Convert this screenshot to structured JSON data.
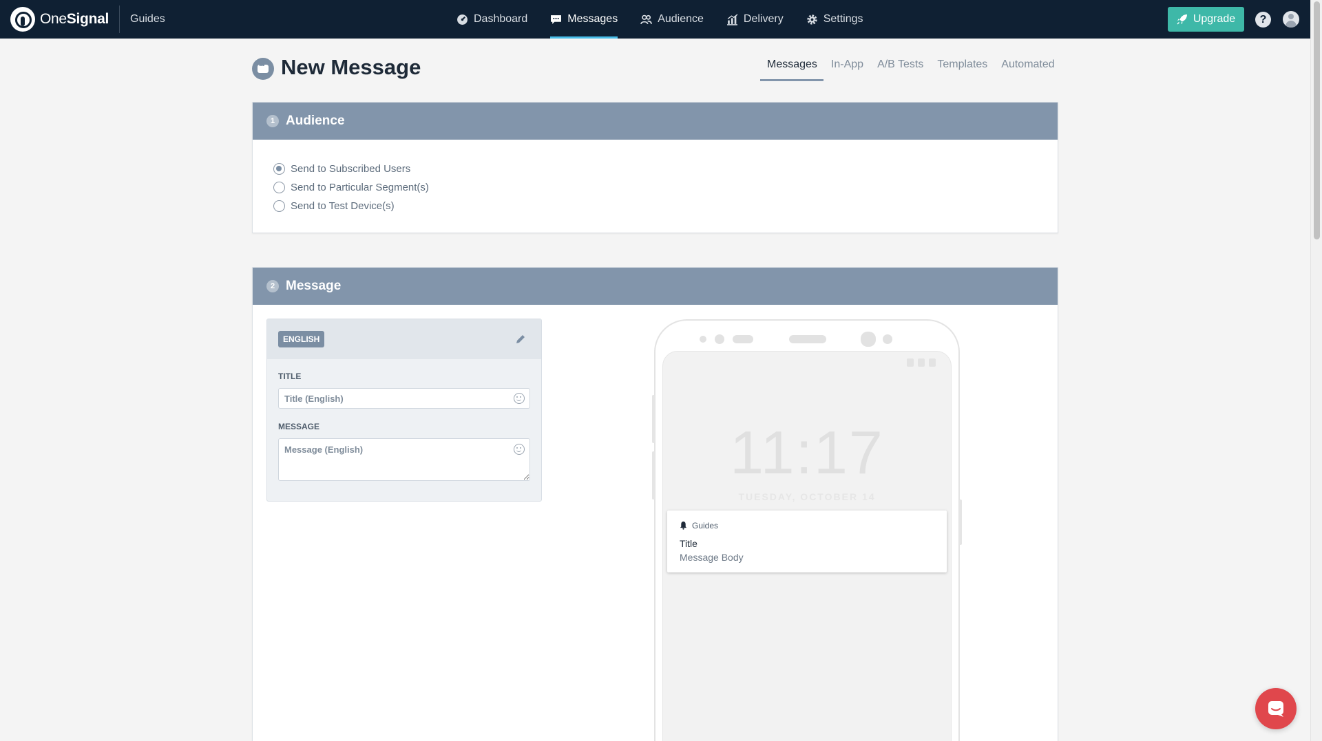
{
  "topbar": {
    "logo_text_1": "One",
    "logo_text_2": "Signal",
    "app_name": "Guides",
    "nav": [
      {
        "label": "Dashboard"
      },
      {
        "label": "Messages"
      },
      {
        "label": "Audience"
      },
      {
        "label": "Delivery"
      },
      {
        "label": "Settings"
      }
    ],
    "active_nav": "Messages",
    "upgrade_label": "Upgrade",
    "help_label": "?"
  },
  "header": {
    "title": "New Message",
    "tabs": [
      {
        "label": "Messages"
      },
      {
        "label": "In-App"
      },
      {
        "label": "A/B Tests"
      },
      {
        "label": "Templates"
      },
      {
        "label": "Automated"
      }
    ],
    "active_tab": "Messages"
  },
  "audience": {
    "step": "1",
    "title": "Audience",
    "options": [
      {
        "label": "Send to Subscribed Users",
        "checked": true
      },
      {
        "label": "Send to Particular Segment(s)",
        "checked": false
      },
      {
        "label": "Send to Test Device(s)",
        "checked": false
      }
    ]
  },
  "message": {
    "step": "2",
    "title": "Message",
    "language": "ENGLISH",
    "title_label": "TITLE",
    "title_placeholder": "Title (English)",
    "title_value": "",
    "message_label": "MESSAGE",
    "message_placeholder": "Message (English)",
    "message_value": ""
  },
  "preview": {
    "time": "11:17",
    "date": "TUESDAY, OCTOBER 14",
    "app": "Guides",
    "title": "Title",
    "body": "Message Body"
  },
  "colors": {
    "topbar": "#0f2033",
    "accent": "#48bde8",
    "upgrade": "#3eb8a8",
    "card_header": "#8295ab",
    "chat": "#e0474c"
  },
  "icons": {
    "dashboard": "dashboard-icon",
    "messages": "messages-icon",
    "audience": "audience-icon",
    "delivery": "delivery-icon",
    "settings": "gear-icon",
    "upgrade": "rocket-icon",
    "help": "help-icon",
    "avatar": "user-avatar-icon",
    "edit": "pencil-icon",
    "emoji": "emoji-icon",
    "chat": "chat-icon"
  }
}
